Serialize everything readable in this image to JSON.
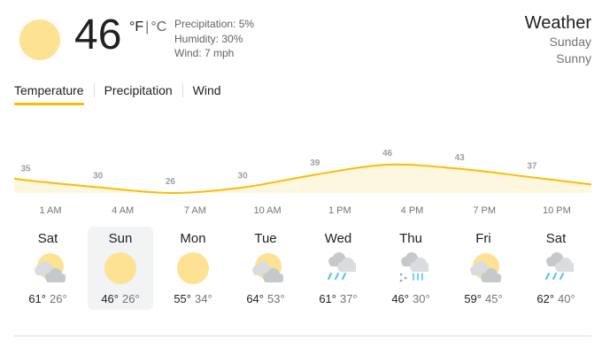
{
  "current": {
    "temperature": "46",
    "unit_f": "°F",
    "unit_sep": "|",
    "unit_c": "°C",
    "icon": "sunny-icon",
    "precipitation": "Precipitation: 5%",
    "humidity": "Humidity: 30%",
    "wind": "Wind: 7 mph"
  },
  "header": {
    "title": "Weather",
    "day": "Sunday",
    "condition": "Sunny"
  },
  "tabs": [
    {
      "label": "Temperature",
      "active": true
    },
    {
      "label": "Precipitation",
      "active": false
    },
    {
      "label": "Wind",
      "active": false
    }
  ],
  "colors": {
    "accent": "#fbbc04",
    "fill": "#fef7e0",
    "sun": "#fde293",
    "cloud": "#dadce0",
    "rain": "#4fc3f7"
  },
  "chart_data": {
    "type": "area",
    "x": [
      "1 AM",
      "4 AM",
      "7 AM",
      "10 AM",
      "1 PM",
      "4 PM",
      "7 PM",
      "10 PM"
    ],
    "values": [
      35,
      30,
      26,
      30,
      39,
      46,
      43,
      37
    ],
    "data_labels": [
      "35",
      "30",
      "26",
      "30",
      "39",
      "46",
      "43",
      "37"
    ],
    "title": "",
    "xlabel": "",
    "ylabel": ""
  },
  "forecast": [
    {
      "day": "Sat",
      "high": "61°",
      "low": "26°",
      "icon": "partly-cloudy-icon"
    },
    {
      "day": "Sun",
      "high": "46°",
      "low": "26°",
      "icon": "sunny-icon"
    },
    {
      "day": "Mon",
      "high": "55°",
      "low": "34°",
      "icon": "sunny-icon"
    },
    {
      "day": "Tue",
      "high": "64°",
      "low": "53°",
      "icon": "partly-cloudy-icon"
    },
    {
      "day": "Wed",
      "high": "61°",
      "low": "37°",
      "icon": "rain-icon"
    },
    {
      "day": "Thu",
      "high": "46°",
      "low": "30°",
      "icon": "snow-rain-icon"
    },
    {
      "day": "Fri",
      "high": "59°",
      "low": "45°",
      "icon": "partly-cloudy-icon"
    },
    {
      "day": "Sat",
      "high": "62°",
      "low": "40°",
      "icon": "rain-icon"
    }
  ],
  "selected_day_index": 1
}
